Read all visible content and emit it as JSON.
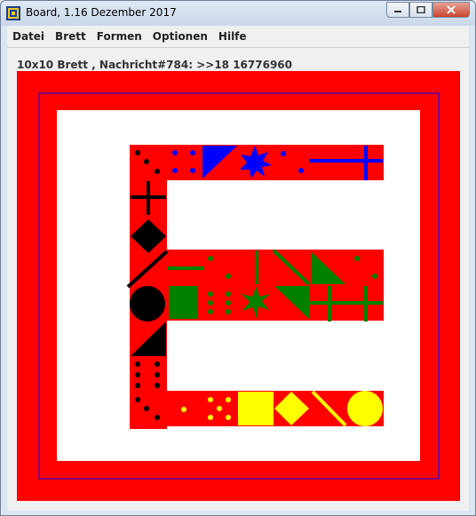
{
  "window": {
    "title": "Board, 1.16 Dezember 2017"
  },
  "menu": {
    "items": [
      "Datei",
      "Brett",
      "Formen",
      "Optionen",
      "Hilfe"
    ]
  },
  "status": {
    "text": "10x10 Brett , Nachricht#784: >>18 16776960"
  },
  "board": {
    "background_color": "#ff0000",
    "inner_frame_color": "#0000ff",
    "center_color": "#ffffff",
    "cell_color": "#ff0000",
    "shape_colors": {
      "black": "#000000",
      "blue": "#0000ff",
      "green": "#008000",
      "yellow": "#ffff00"
    }
  }
}
